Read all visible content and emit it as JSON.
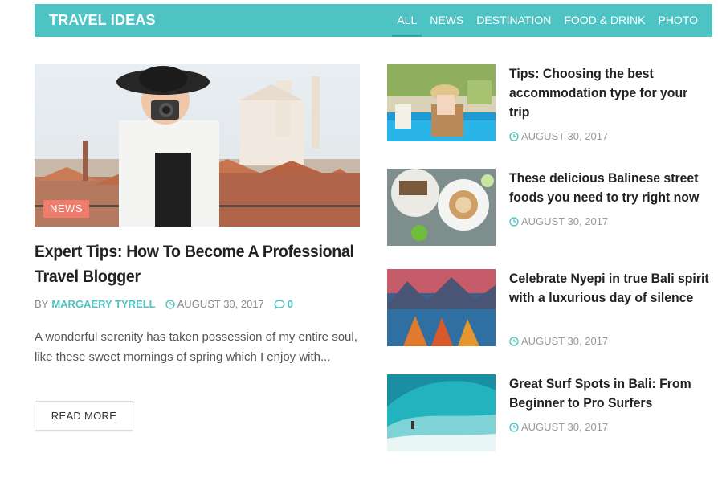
{
  "header": {
    "brand": "TRAVEL IDEAS",
    "tabs": [
      {
        "label": "ALL",
        "active": true
      },
      {
        "label": "NEWS"
      },
      {
        "label": "DESTINATION"
      },
      {
        "label": "FOOD & DRINK"
      },
      {
        "label": "PHOTO"
      }
    ]
  },
  "feature": {
    "badge": "NEWS",
    "title": "Expert Tips: How To Become A Professional Travel Blogger",
    "by": "BY",
    "author": "MARGAERY TYRELL",
    "date": "AUGUST 30, 2017",
    "comments": "0",
    "excerpt": "A wonderful serenity has taken possession of my entire soul, like these sweet mornings of spring which I enjoy with...",
    "read_more": "READ MORE"
  },
  "side_posts": [
    {
      "title": "Tips: Choosing the best accommodation type for your trip",
      "date": "AUGUST 30, 2017"
    },
    {
      "title": "These delicious Balinese street foods you need to try right now",
      "date": "AUGUST 30, 2017"
    },
    {
      "title": "Celebrate Nyepi in true Bali spirit with a luxurious day of silence",
      "date": "AUGUST 30, 2017"
    },
    {
      "title": "Great Surf Spots in Bali: From Beginner to Pro Surfers",
      "date": "AUGUST 30, 2017"
    }
  ],
  "colors": {
    "accent": "#4ec3c4",
    "badge": "#f07c6c"
  }
}
